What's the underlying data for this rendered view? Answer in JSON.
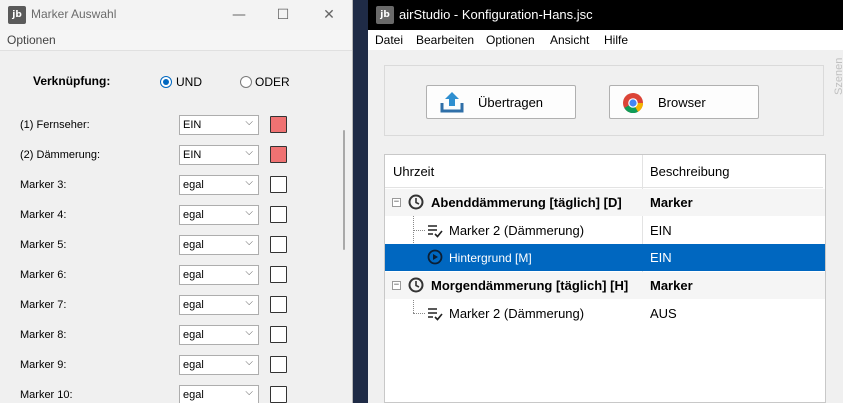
{
  "left_window": {
    "logo": "jb",
    "title": "Marker Auswahl",
    "controls": {
      "minimize": "—",
      "maximize": "☐",
      "close": "✕"
    },
    "menu": [
      "Optionen"
    ],
    "verknuepfung_label": "Verknüpfung:",
    "radio_und": "UND",
    "radio_oder": "ODER",
    "selected_mode": "UND",
    "markers": [
      {
        "label": "(1) Fernseher:",
        "value": "EIN",
        "color": "#ef7272"
      },
      {
        "label": "(2) Dämmerung:",
        "value": "EIN",
        "color": "#ef7272"
      },
      {
        "label": "Marker 3:",
        "value": "egal",
        "color": "#ffffff"
      },
      {
        "label": "Marker 4:",
        "value": "egal",
        "color": "#ffffff"
      },
      {
        "label": "Marker 5:",
        "value": "egal",
        "color": "#ffffff"
      },
      {
        "label": "Marker 6:",
        "value": "egal",
        "color": "#ffffff"
      },
      {
        "label": "Marker 7:",
        "value": "egal",
        "color": "#ffffff"
      },
      {
        "label": "Marker 8:",
        "value": "egal",
        "color": "#ffffff"
      },
      {
        "label": "Marker 9:",
        "value": "egal",
        "color": "#ffffff"
      },
      {
        "label": "Marker 10:",
        "value": "egal",
        "color": "#ffffff"
      }
    ]
  },
  "right_window": {
    "logo": "jb",
    "title": "airStudio - Konfiguration-Hans.jsc",
    "menu": [
      "Datei",
      "Bearbeiten",
      "Optionen",
      "Ansicht",
      "Hilfe"
    ],
    "toolbar": {
      "upload_label": "Übertragen",
      "browser_label": "Browser"
    },
    "side_label": "Szenen",
    "tree": {
      "col_time": "Uhrzeit",
      "col_desc": "Beschreibung",
      "rows": [
        {
          "time": "Abenddämmerung [täglich] [D]",
          "desc": "Marker"
        },
        {
          "time": "Marker 2 (Dämmerung)",
          "desc": "EIN"
        },
        {
          "time": "Hintergrund [M]",
          "desc": "EIN"
        },
        {
          "time": "Morgendämmerung [täglich] [H]",
          "desc": "Marker"
        },
        {
          "time": "Marker 2 (Dämmerung)",
          "desc": "AUS"
        }
      ]
    }
  },
  "colors": {
    "accent": "#0067c0",
    "marker_active": "#ef7272"
  }
}
